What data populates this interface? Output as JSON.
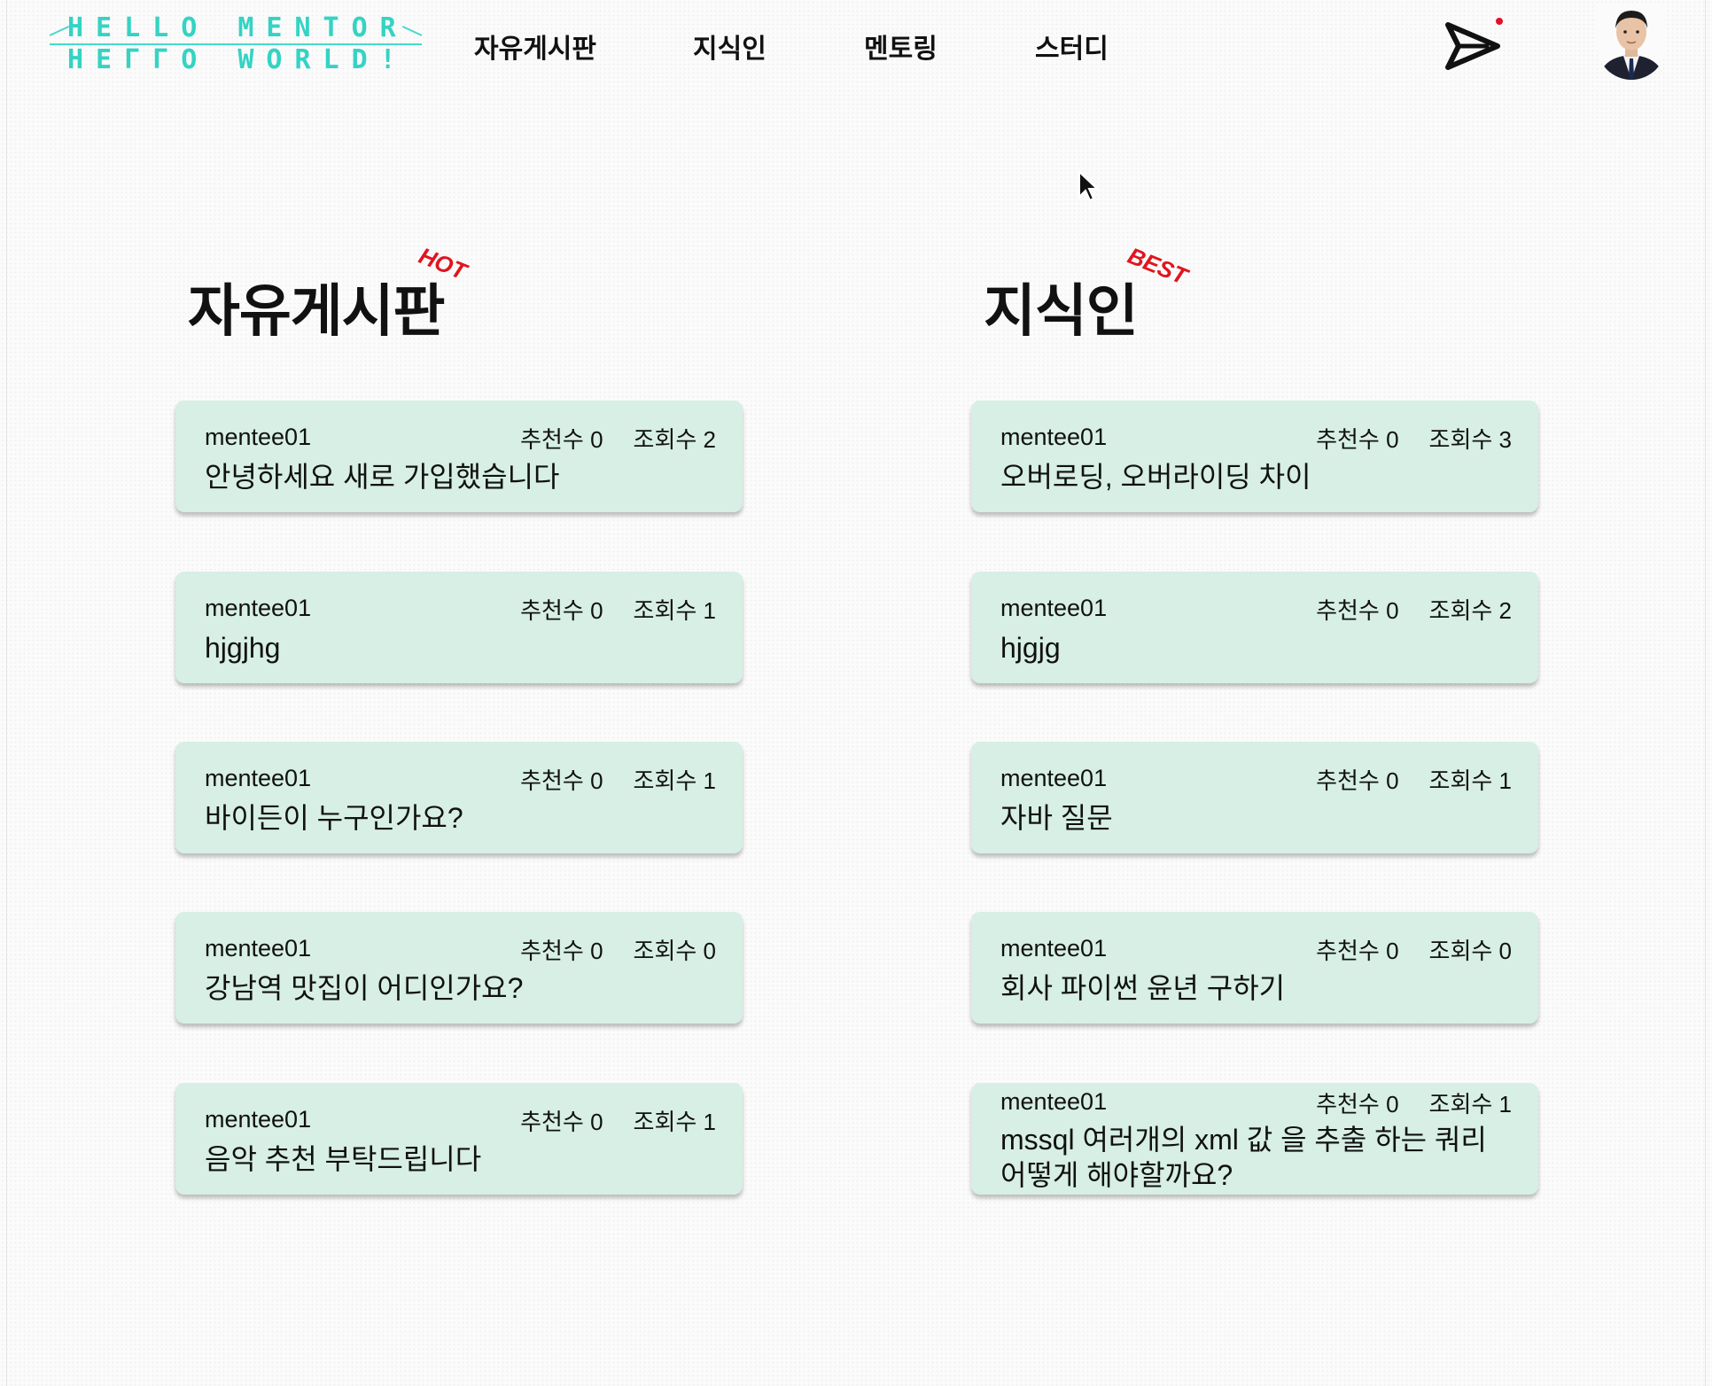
{
  "header": {
    "logo_line1": "HELLO MENTOR",
    "logo_line2": "HEΓΓO WORLD!",
    "nav": [
      "자유게시판",
      "지식인",
      "멘토링",
      "스터디"
    ]
  },
  "free_board": {
    "title": "자유게시판",
    "badge": "HOT",
    "posts": [
      {
        "author": "mentee01",
        "likes": "추천수 0",
        "views": "조회수 2",
        "title": "안녕하세요 새로 가입했습니다"
      },
      {
        "author": "mentee01",
        "likes": "추천수 0",
        "views": "조회수 1",
        "title": "hjgjhg"
      },
      {
        "author": "mentee01",
        "likes": "추천수 0",
        "views": "조회수 1",
        "title": "바이든이 누구인가요?"
      },
      {
        "author": "mentee01",
        "likes": "추천수 0",
        "views": "조회수 0",
        "title": "강남역 맛집이 어디인가요?"
      },
      {
        "author": "mentee01",
        "likes": "추천수 0",
        "views": "조회수 1",
        "title": "음악 추천 부탁드립니다"
      }
    ]
  },
  "knowledge": {
    "title": "지식인",
    "badge": "BEST",
    "posts": [
      {
        "author": "mentee01",
        "likes": "추천수 0",
        "views": "조회수 3",
        "title": "오버로딩, 오버라이딩 차이"
      },
      {
        "author": "mentee01",
        "likes": "추천수 0",
        "views": "조회수 2",
        "title": "hjgjg"
      },
      {
        "author": "mentee01",
        "likes": "추천수 0",
        "views": "조회수 1",
        "title": "자바 질문"
      },
      {
        "author": "mentee01",
        "likes": "추천수 0",
        "views": "조회수 0",
        "title": "회사 파이썬 윤년 구하기"
      },
      {
        "author": "mentee01",
        "likes": "추천수 0",
        "views": "조회수 1",
        "title": "mssql 여러개의 xml 값 을 추출 하는 쿼리 어떻게 해야할까요?"
      }
    ]
  },
  "icons": {
    "send": "send-icon",
    "avatar": "user-avatar",
    "cursor": "mouse-cursor-icon"
  },
  "colors": {
    "logo": "#34d3c3",
    "card_bg": "#d7efe5",
    "badge": "#e0151f",
    "notification": "#e0122a"
  }
}
